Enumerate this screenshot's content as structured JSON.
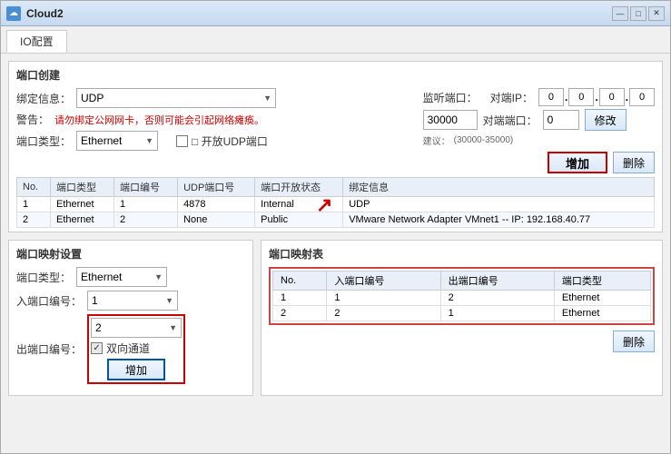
{
  "window": {
    "title": "Cloud2",
    "icon": "☁",
    "buttons": [
      "—",
      "□",
      "✕"
    ]
  },
  "tab": {
    "label": "IO配置"
  },
  "port_creation": {
    "section_title": "端口创建",
    "bind_label": "绑定信息：",
    "bind_value": "UDP",
    "warning_label": "警告：",
    "warning_text": "请勿绑定公网网卡，否则可能会引起网络瘫痪。",
    "port_type_label": "端口类型：",
    "port_type_value": "Ethernet",
    "udp_port_label": "□ 开放UDP端口",
    "listen_port_label": "监听端口：",
    "listen_port_value": "30000",
    "opposite_ip_label": "对端IP：",
    "opposite_ip_segments": [
      "0",
      "0",
      "0",
      "0"
    ],
    "opposite_port_label": "对端端口：",
    "opposite_port_value": "0",
    "suggestion_label": "建议：",
    "suggestion_value": "(30000-35000)",
    "add_button": "增加",
    "modify_button": "修改",
    "delete_button": "删除",
    "table": {
      "headers": [
        "No.",
        "端口类型",
        "端口编号",
        "UDP端口号",
        "端口开放状态",
        "绑定信息"
      ],
      "rows": [
        {
          "no": "1",
          "type": "Ethernet",
          "num": "1",
          "udp": "4878",
          "status": "Internal",
          "binding": "UDP"
        },
        {
          "no": "2",
          "type": "Ethernet",
          "num": "2",
          "udp": "None",
          "status": "Public",
          "binding": "VMware Network Adapter VMnet1 -- IP: 192.168.40.77"
        }
      ]
    }
  },
  "port_mapping_settings": {
    "section_title": "端口映射设置",
    "port_type_label": "端口类型：",
    "port_type_value": "Ethernet",
    "in_port_label": "入端口编号：",
    "in_port_value": "1",
    "out_port_label": "出端口编号：",
    "out_port_value": "2",
    "bidirectional_label": "双向通道",
    "add_button": "增加"
  },
  "port_mapping_table": {
    "section_title": "端口映射表",
    "headers": [
      "No.",
      "入端口编号",
      "出端口编号",
      "端口类型"
    ],
    "rows": [
      {
        "no": "1",
        "in": "1",
        "out": "2",
        "type": "Ethernet"
      },
      {
        "no": "2",
        "in": "2",
        "out": "1",
        "type": "Ethernet"
      }
    ],
    "delete_button": "删除"
  }
}
